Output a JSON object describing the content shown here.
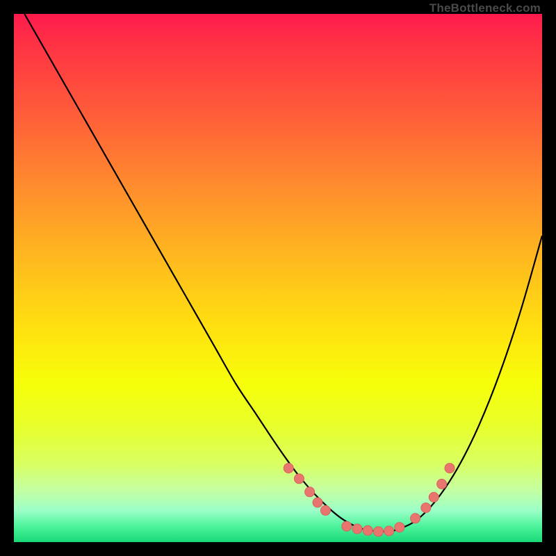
{
  "attribution": "TheBottleneck.com",
  "colors": {
    "frame": "#000000",
    "curve_stroke": "#000000",
    "marker_fill": "#e8766f",
    "marker_stroke": "#d8615f",
    "gradient_top": "#ff1a4d",
    "gradient_bottom": "#18d877"
  },
  "chart_data": {
    "type": "line",
    "title": "",
    "xlabel": "",
    "ylabel": "",
    "xlim": [
      0,
      100
    ],
    "ylim": [
      0,
      100
    ],
    "grid": false,
    "legend": false,
    "series": [
      {
        "name": "curve",
        "x": [
          2,
          6,
          10,
          14,
          18,
          22,
          26,
          30,
          34,
          38,
          42,
          46,
          50,
          54,
          58,
          62,
          66,
          70,
          72,
          76,
          80,
          84,
          88,
          92,
          96,
          100
        ],
        "y": [
          100,
          93,
          86,
          79,
          72,
          65,
          58,
          51,
          44,
          37,
          30,
          24,
          18,
          12.5,
          8,
          4.5,
          2.5,
          2,
          2.2,
          4,
          8,
          14,
          22,
          32,
          44,
          58
        ]
      }
    ],
    "markers": [
      {
        "x": 52,
        "y": 14
      },
      {
        "x": 54,
        "y": 12
      },
      {
        "x": 56,
        "y": 9.5
      },
      {
        "x": 57.5,
        "y": 7.5
      },
      {
        "x": 59,
        "y": 6
      },
      {
        "x": 63,
        "y": 3
      },
      {
        "x": 65,
        "y": 2.5
      },
      {
        "x": 67,
        "y": 2.2
      },
      {
        "x": 69,
        "y": 2
      },
      {
        "x": 71,
        "y": 2.1
      },
      {
        "x": 73,
        "y": 2.8
      },
      {
        "x": 76,
        "y": 4.5
      },
      {
        "x": 78,
        "y": 6.5
      },
      {
        "x": 79.5,
        "y": 8.5
      },
      {
        "x": 81,
        "y": 11
      },
      {
        "x": 82.5,
        "y": 14
      }
    ]
  }
}
